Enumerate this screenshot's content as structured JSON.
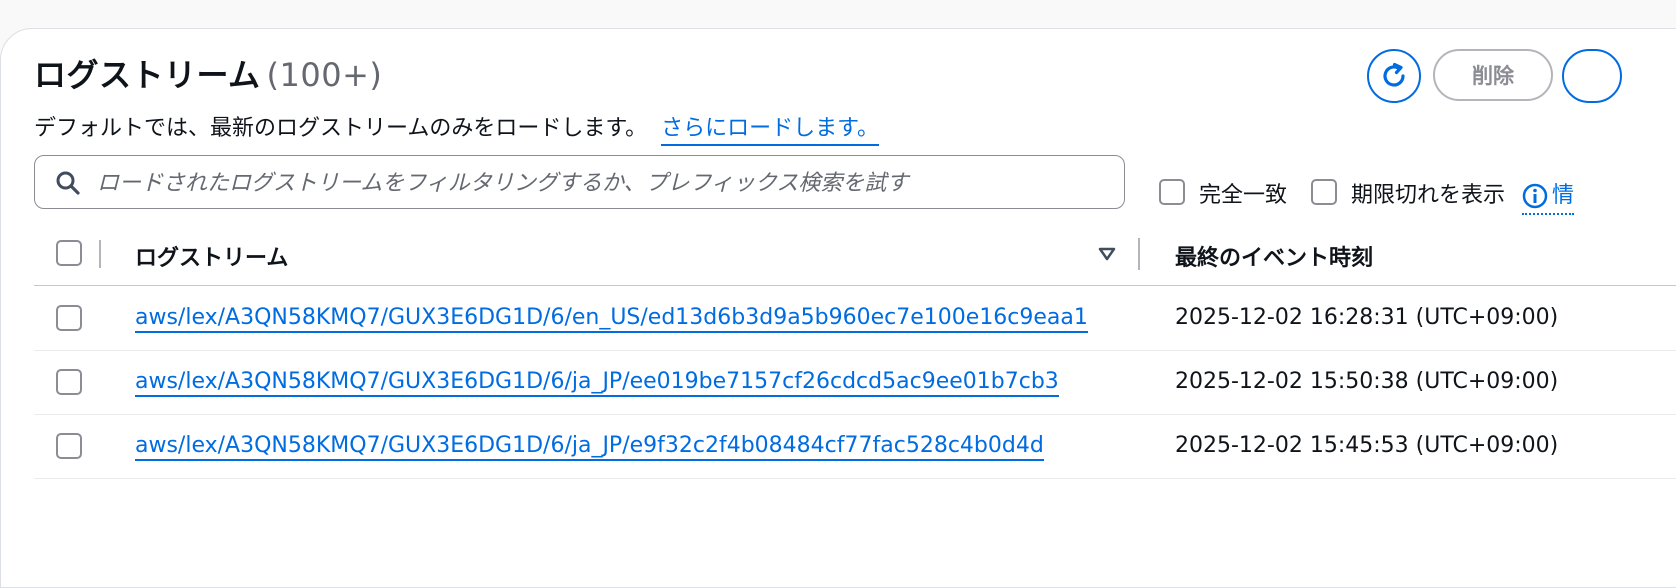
{
  "header": {
    "title": "ログストリーム",
    "count": "(100+)",
    "description": "デフォルトでは、最新のログストリームのみをロードします。",
    "load_more_link": "さらにロードします。",
    "delete_label": "削除"
  },
  "search": {
    "placeholder": "ロードされたログストリームをフィルタリングするか、プレフィックス検索を試す",
    "value": ""
  },
  "options": {
    "exact_match_label": "完全一致",
    "show_expired_label": "期限切れを表示",
    "info_link_partial": "情"
  },
  "table": {
    "columns": [
      "ログストリーム",
      "最終のイベント時刻"
    ],
    "rows": [
      {
        "stream": "aws/lex/A3QN58KMQ7/GUX3E6DG1D/6/en_US/ed13d6b3d9a5b960ec7e100e16c9eaa1",
        "time": "2025-12-02 16:28:31 (UTC+09:00)"
      },
      {
        "stream": "aws/lex/A3QN58KMQ7/GUX3E6DG1D/6/ja_JP/ee019be7157cf26cdcd5ac9ee01b7cb3",
        "time": "2025-12-02 15:50:38 (UTC+09:00)"
      },
      {
        "stream": "aws/lex/A3QN58KMQ7/GUX3E6DG1D/6/ja_JP/e9f32c2f4b08484cf77fac528c4b0d4d",
        "time": "2025-12-02 15:45:53 (UTC+09:00)"
      }
    ]
  },
  "icons": {
    "refresh": "refresh-icon",
    "search": "search-icon",
    "info": "info-icon",
    "sort": "sort-descending-icon"
  },
  "colors": {
    "link": "#006ce0",
    "text": "#0f141a",
    "muted": "#656871",
    "border": "#8c8c94"
  }
}
